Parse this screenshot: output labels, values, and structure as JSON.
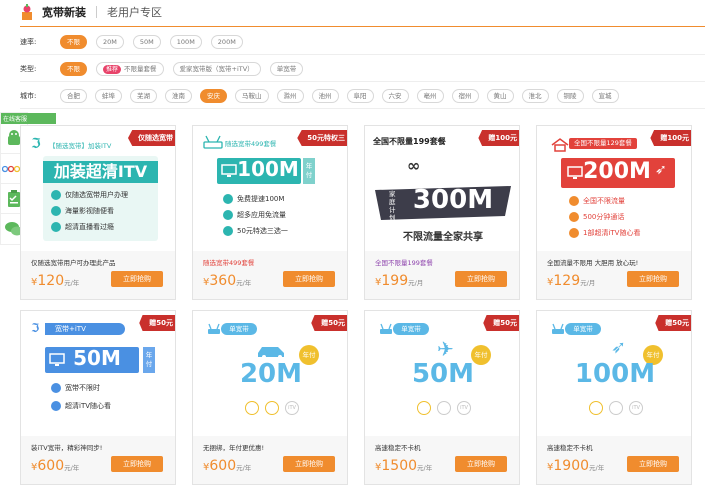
{
  "header": {
    "title": "宽带新装",
    "subtitle": "老用户专区"
  },
  "filters": {
    "speed": {
      "label": "速率:",
      "options": [
        "不限",
        "20M",
        "50M",
        "100M",
        "200M"
      ]
    },
    "type": {
      "label": "类型:",
      "options": [
        "不限",
        "推荐",
        "不限量套餐",
        "爱家宽带版（宽带+iTV）",
        "单宽带"
      ],
      "recommend_tag": "推荐"
    },
    "city": {
      "label": "城市:",
      "options": [
        "合肥",
        "蚌埠",
        "芜湖",
        "淮南",
        "安庆",
        "马鞍山",
        "滁州",
        "池州",
        "阜阳",
        "六安",
        "亳州",
        "宿州",
        "黄山",
        "淮北",
        "铜陵",
        "宣城"
      ]
    }
  },
  "sidebar": {
    "header": "在线客服"
  },
  "cards": [
    {
      "ribbon": "仅随选宽带",
      "banner_top": "【随选宽带】加装ITV",
      "banner_big": "加装超清ITV",
      "features": [
        "仅随选宽带用户办理",
        "海量影视随便看",
        "超清直播看过瘾"
      ],
      "desc": "仅随选宽带用户可办理此产品",
      "price_cur": "¥",
      "price": "120",
      "unit": "元/年",
      "buy": "立即抢购"
    },
    {
      "ribbon": "50元特权三",
      "banner_top": "随选宽带499套餐",
      "banner_big": "100M",
      "banner_tag": "年付",
      "features": [
        "免费提速100M",
        "超多应用免流量",
        "50元特选三选一"
      ],
      "desc": "随选宽带499套餐",
      "price_cur": "¥",
      "price": "360",
      "unit": "元/年",
      "buy": "立即抢购"
    },
    {
      "ribbon": "赠100元",
      "banner_top": "全国不限量199套餐",
      "banner_side": "家庭计划",
      "banner_big": "300M",
      "banner_bottom": "不限流量全家共享",
      "desc": "全国不限量199套餐",
      "price_cur": "¥",
      "price": "199",
      "unit": "元/月",
      "buy": "立即抢购"
    },
    {
      "ribbon": "赠100元",
      "banner_top": "全国不限量129套餐",
      "banner_big": "200M",
      "features": [
        "全国不限流量",
        "500分钟通话",
        "1部超清iTV随心看"
      ],
      "desc": "全国流量不限用 大胆用 放心玩!",
      "price_cur": "¥",
      "price": "129",
      "unit": "元/月",
      "buy": "立即抢购"
    },
    {
      "ribbon": "赠50元",
      "banner_top": "宽带+iTV",
      "banner_big": "50M",
      "banner_tag": "年付",
      "features": [
        "宽带不限时",
        "超清iTV随心看"
      ],
      "desc": "装iTV宽带，精彩神同步!",
      "price_cur": "¥",
      "price": "600",
      "unit": "元/年",
      "buy": "立即抢购"
    },
    {
      "ribbon": "赠50元",
      "banner_top": "单宽带",
      "banner_big": "20M",
      "banner_tag": "年付",
      "itv": "iTV",
      "desc": "无捆绑，年付更优惠!",
      "price_cur": "¥",
      "price": "600",
      "unit": "元/年",
      "buy": "立即抢购"
    },
    {
      "ribbon": "赠50元",
      "banner_top": "单宽带",
      "banner_big": "50M",
      "banner_tag": "年付",
      "itv": "iTV",
      "desc": "高速稳定不卡机",
      "price_cur": "¥",
      "price": "1500",
      "unit": "元/年",
      "buy": "立即抢购"
    },
    {
      "ribbon": "赠50元",
      "banner_top": "单宽带",
      "banner_big": "100M",
      "banner_tag": "年付",
      "itv": "iTV",
      "desc": "高速稳定不卡机",
      "price_cur": "¥",
      "price": "1900",
      "unit": "元/年",
      "buy": "立即抢购"
    }
  ],
  "colors": {
    "accent": "#f08c2e",
    "ribbon": "#c9302c",
    "teal": "#2cb5b0",
    "blue": "#4a90e2",
    "sky": "#5bb8e6",
    "red": "#e2423b",
    "purple": "#8e44ad"
  }
}
